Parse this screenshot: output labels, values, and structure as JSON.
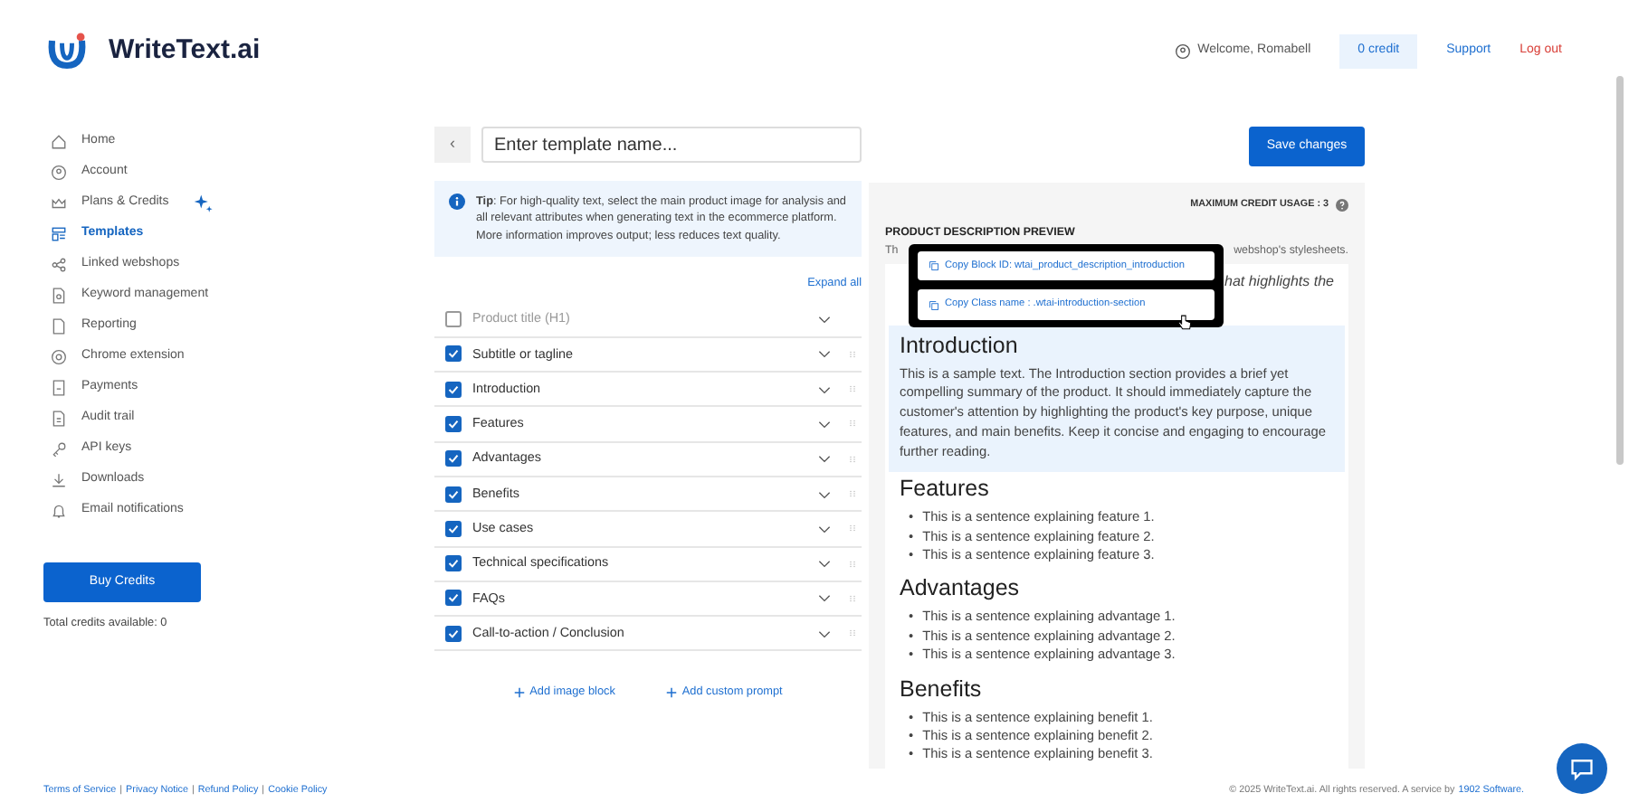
{
  "brand": {
    "name": "WriteText.ai"
  },
  "header": {
    "welcome": "Welcome, Romabell",
    "credit": "0 credit",
    "support": "Support",
    "logout": "Log out"
  },
  "sidebar": {
    "items": [
      {
        "label": "Home",
        "selected": false,
        "sparkle": false
      },
      {
        "label": "Account",
        "selected": false,
        "sparkle": false
      },
      {
        "label": "Plans & Credits",
        "selected": false,
        "sparkle": true
      },
      {
        "label": "Templates",
        "selected": true,
        "sparkle": false
      },
      {
        "label": "Linked webshops",
        "selected": false,
        "sparkle": false
      },
      {
        "label": "Keyword management",
        "selected": false,
        "sparkle": false
      },
      {
        "label": "Reporting",
        "selected": false,
        "sparkle": false
      },
      {
        "label": "Chrome extension",
        "selected": false,
        "sparkle": false
      },
      {
        "label": "Payments",
        "selected": false,
        "sparkle": false
      },
      {
        "label": "Audit trail",
        "selected": false,
        "sparkle": false
      },
      {
        "label": "API keys",
        "selected": false,
        "sparkle": false
      },
      {
        "label": "Downloads",
        "selected": false,
        "sparkle": false
      },
      {
        "label": "Email notifications",
        "selected": false,
        "sparkle": false
      }
    ],
    "buy_button": "Buy Credits",
    "total_credits": "Total credits available: 0"
  },
  "editor": {
    "back": "‹",
    "name_field": {
      "placeholder": "Enter template name..."
    },
    "tip": "**Tip**: For high-quality text, select the main product image for analysis and all relevant attributes when generating text in the ecommerce platform. More information improves output; less reduces text quality.",
    "expand_all": "Expand all",
    "sections": [
      {
        "label": "Product title (H1)",
        "checked": false,
        "draggable": false
      },
      {
        "label": "Subtitle or tagline",
        "checked": true,
        "draggable": true
      },
      {
        "label": "Introduction",
        "checked": true,
        "draggable": true
      },
      {
        "label": "Features",
        "checked": true,
        "draggable": true
      },
      {
        "label": "Advantages",
        "checked": true,
        "draggable": true
      },
      {
        "label": "Benefits",
        "checked": true,
        "draggable": true
      },
      {
        "label": "Use cases",
        "checked": true,
        "draggable": true
      },
      {
        "label": "Technical specifications",
        "checked": true,
        "draggable": true
      },
      {
        "label": "FAQs",
        "checked": true,
        "draggable": true
      },
      {
        "label": "Call-to-action / Conclusion",
        "checked": true,
        "draggable": true
      }
    ],
    "add_buttons": [
      "Add image block",
      "Add custom prompt"
    ]
  },
  "save_button": "Save changes",
  "preview": {
    "credit_usage": "MAXIMUM CREDIT USAGE : 3",
    "title": "PRODUCT DESCRIPTION PREVIEW",
    "note_start": "Th",
    "note_end": "webshop's stylesheets.",
    "tagline_fragment": "hat highlights the",
    "bullet": "•",
    "blocks": [
      {
        "kind": "paragraph",
        "heading": "Introduction",
        "highlighted": true,
        "text": "This is a sample text. The Introduction section provides a brief yet compelling summary of the product. It should immediately capture the customer's attention by highlighting the product's key purpose, unique features, and main benefits. Keep it concise and engaging to encourage further reading."
      },
      {
        "kind": "list",
        "heading": "Features",
        "highlighted": false,
        "items": [
          "This is a sentence explaining feature 1.",
          "This is a sentence explaining feature 2.",
          "This is a sentence explaining feature 3."
        ]
      },
      {
        "kind": "list",
        "heading": "Advantages",
        "highlighted": false,
        "items": [
          "This is a sentence explaining advantage 1.",
          "This is a sentence explaining advantage 2.",
          "This is a sentence explaining advantage 3."
        ]
      },
      {
        "kind": "list",
        "heading": "Benefits",
        "highlighted": false,
        "items": [
          "This is a sentence explaining benefit 1.",
          "This is a sentence explaining benefit 2.",
          "This is a sentence explaining benefit 3."
        ]
      }
    ],
    "popup": [
      "Copy Block ID: wtai_product_description_introduction",
      "Copy Class name : .wtai-introduction-section"
    ]
  },
  "footer": {
    "links": [
      "Terms of Service",
      "Privacy Notice",
      "Refund Policy",
      "Cookie Policy"
    ],
    "separator": "|",
    "copyright": "© 2025 WriteText.ai. All rights reserved. A service by",
    "company": "1902 Software."
  }
}
